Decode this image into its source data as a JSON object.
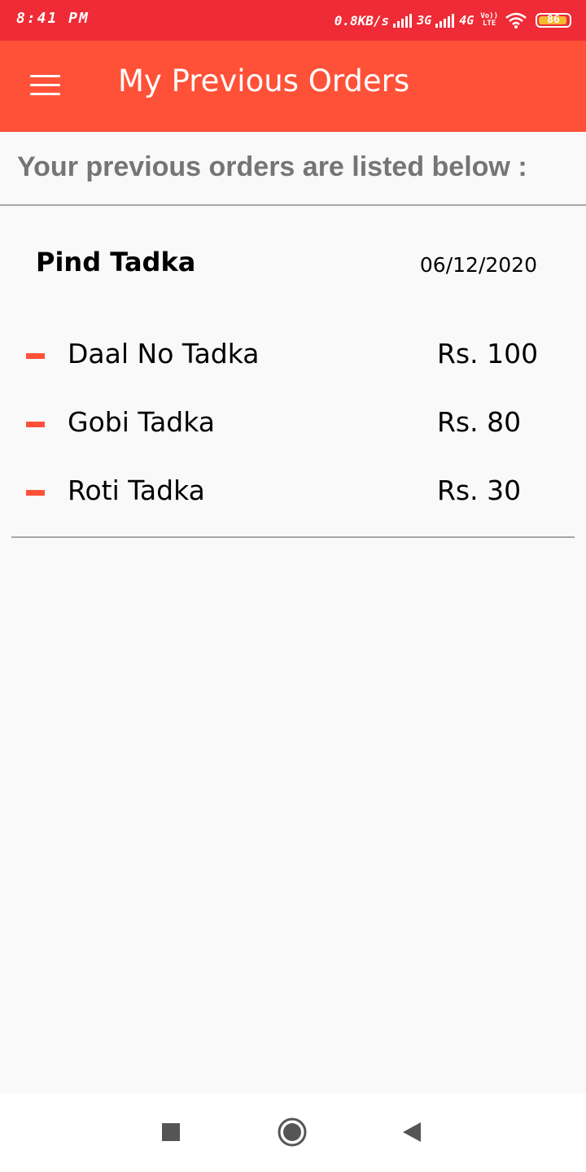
{
  "status_bar": {
    "time": "8:41 PM",
    "network_speed": "0.8KB/s",
    "network_3g": "3G",
    "network_4g": "4G",
    "volte_top": "Vo))",
    "volte_bottom": "LTE",
    "battery": "86",
    "icons": [
      "signal-icon",
      "signal-icon",
      "volte-icon",
      "wifi-icon",
      "battery-icon"
    ]
  },
  "app_bar": {
    "menu_icon": "hamburger-menu-icon",
    "title": "My Previous Orders"
  },
  "subtitle": "Your previous orders are listed below :",
  "orders": [
    {
      "restaurant": "Pind Tadka",
      "date": "06/12/2020",
      "items": [
        {
          "name": "Daal No Tadka",
          "price": "Rs. 100"
        },
        {
          "name": "Gobi Tadka",
          "price": "Rs. 80"
        },
        {
          "name": "Roti Tadka",
          "price": "Rs. 30"
        }
      ]
    }
  ],
  "nav_bar": {
    "icons": [
      "recents-square-icon",
      "home-circle-icon",
      "back-triangle-icon"
    ]
  },
  "colors": {
    "status_bar": "#ee2b36",
    "app_bar": "#ff5138",
    "accent": "#ff5138",
    "background": "#f9f9f9",
    "subtitle_text": "#757575"
  }
}
